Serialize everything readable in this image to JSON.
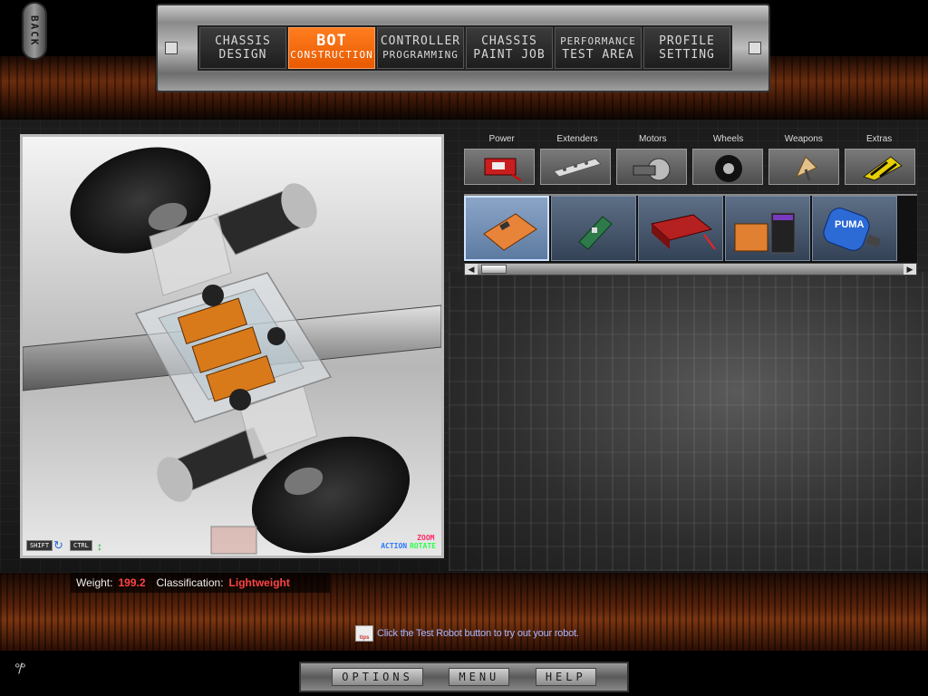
{
  "back_label": "BACK",
  "nav_tabs": [
    {
      "line1": "CHASSIS",
      "line2": "DESIGN"
    },
    {
      "line1": "BOT",
      "line2": "CONSTRUCTION"
    },
    {
      "line1": "CONTROLLER",
      "line2": "PROGRAMMING"
    },
    {
      "line1": "CHASSIS",
      "line2": "PAINT JOB"
    },
    {
      "line1": "PERFORMANCE",
      "line2": "TEST AREA"
    },
    {
      "line1": "PROFILE",
      "line2": "SETTING"
    }
  ],
  "active_tab": "BOT CONSTRUCTION",
  "viewport": {
    "hint_shift": "SHIFT",
    "hint_ctrl": "CTRL",
    "hint_action": "ACTION",
    "hint_zoom": "ZOOM",
    "hint_rotate": "ROTATE"
  },
  "categories": [
    "Power",
    "Extenders",
    "Motors",
    "Wheels",
    "Weapons",
    "Extras"
  ],
  "category_icons": [
    "battery-icon",
    "extender-bar-icon",
    "motor-icon",
    "wheel-icon",
    "weapon-blade-icon",
    "extras-hazard-icon"
  ],
  "parts": [
    {
      "icon": "battery-pack-orange-icon",
      "selected": true
    },
    {
      "icon": "circuit-board-icon",
      "selected": false
    },
    {
      "icon": "battery-red-icon",
      "selected": false
    },
    {
      "icon": "battery-pair-icon",
      "selected": false
    },
    {
      "icon": "puma-battery-icon",
      "selected": false,
      "label": "PUMA"
    }
  ],
  "status": {
    "weight_label": "Weight:",
    "weight_value": "199.2",
    "class_label": "Classification:",
    "class_value": "Lightweight"
  },
  "tip": {
    "icon_label": "tips",
    "text": "Click the Test Robot button to try out your robot."
  },
  "bottom_menu": [
    "OPTIONS",
    "MENU",
    "HELP"
  ],
  "colors": {
    "accent": "#ff7d1f",
    "weight_value": "#ff4444",
    "tip_text": "#a9b6ff"
  }
}
